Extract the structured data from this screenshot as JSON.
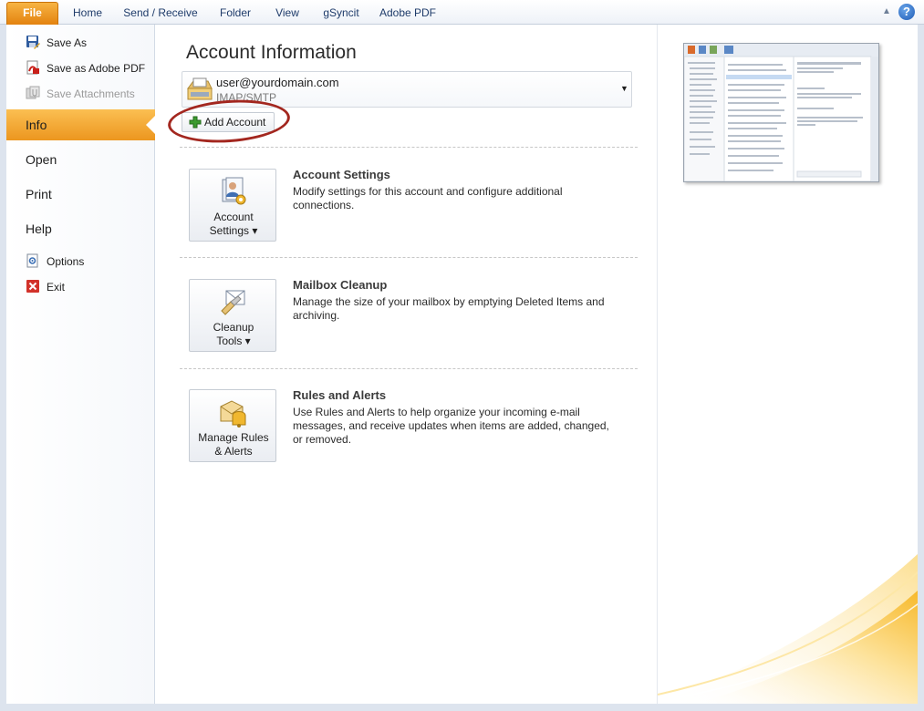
{
  "ribbon": {
    "file_tab": "File",
    "tabs": [
      "Home",
      "Send / Receive",
      "Folder",
      "View",
      "gSyncit",
      "Adobe PDF"
    ],
    "help": "?"
  },
  "nav": {
    "save_as": "Save As",
    "save_as_pdf": "Save as Adobe PDF",
    "save_attachments": "Save Attachments",
    "info": "Info",
    "open": "Open",
    "print": "Print",
    "help": "Help",
    "options": "Options",
    "exit": "Exit"
  },
  "main": {
    "title": "Account Information",
    "account": {
      "email": "user@yourdomain.com",
      "type": "IMAP/SMTP"
    },
    "add_account": "Add Account",
    "sections": [
      {
        "button_label": "Account\nSettings ▾",
        "title": "Account Settings",
        "description": "Modify settings for this account and configure additional connections."
      },
      {
        "button_label": "Cleanup\nTools ▾",
        "title": "Mailbox Cleanup",
        "description": "Manage the size of your mailbox by emptying Deleted Items and archiving."
      },
      {
        "button_label": "Manage Rules\n& Alerts",
        "title": "Rules and Alerts",
        "description": "Use Rules and Alerts to help organize your incoming e-mail messages, and receive updates when items are added, changed, or removed."
      }
    ]
  },
  "colors": {
    "file_tab": "#e88a14",
    "selected_nav": "#f2a630",
    "ribbon_text": "#1e3b6a",
    "annotation_circle": "#a3271f"
  }
}
